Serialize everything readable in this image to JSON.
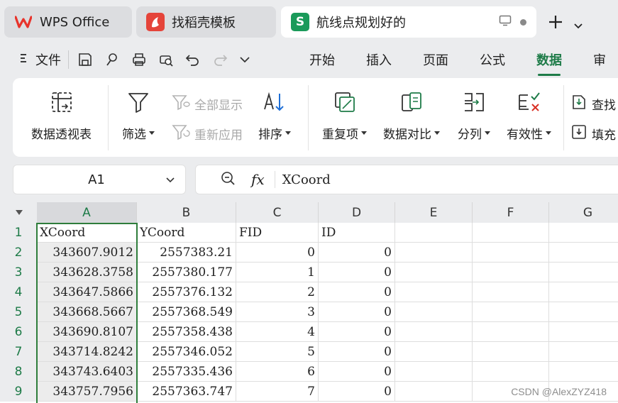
{
  "tabs": [
    {
      "label": "WPS Office",
      "icon": "wps-logo-icon"
    },
    {
      "label": "找稻壳模板",
      "icon": "docer-icon"
    },
    {
      "label": "航线点规划好的",
      "icon": "spreadsheet-icon",
      "icon_letter": "S"
    }
  ],
  "menu": {
    "file_label": "文件",
    "tabs": [
      "开始",
      "插入",
      "页面",
      "公式",
      "数据",
      "审"
    ],
    "active_tab": "数据"
  },
  "ribbon": {
    "pivot": "数据透视表",
    "filter": "筛选",
    "show_all": "全部显示",
    "reapply": "重新应用",
    "sort": "排序",
    "duplicates": "重复项",
    "compare": "数据对比",
    "split": "分列",
    "validity": "有效性",
    "find": "查找",
    "fill": "填充"
  },
  "formula_bar": {
    "name_box": "A1",
    "fx_label": "fx",
    "value": "XCoord"
  },
  "grid": {
    "columns": [
      "A",
      "B",
      "C",
      "D",
      "E",
      "F",
      "G"
    ],
    "rows": [
      "1",
      "2",
      "3",
      "4",
      "5",
      "6",
      "7",
      "8",
      "9"
    ],
    "cells": [
      [
        "XCoord",
        "YCoord",
        "FID",
        "ID"
      ],
      [
        "343607.9012",
        "2557383.21",
        "0",
        "0"
      ],
      [
        "343628.3758",
        "2557380.177",
        "1",
        "0"
      ],
      [
        "343647.5866",
        "2557376.132",
        "2",
        "0"
      ],
      [
        "343668.5667",
        "2557368.549",
        "3",
        "0"
      ],
      [
        "343690.8107",
        "2557358.438",
        "4",
        "0"
      ],
      [
        "343714.8242",
        "2557346.052",
        "5",
        "0"
      ],
      [
        "343743.6403",
        "2557335.436",
        "6",
        "0"
      ],
      [
        "343757.7956",
        "2557363.747",
        "7",
        "0"
      ]
    ],
    "selected_cell": "A1"
  },
  "watermark": "CSDN @AlexZYZ418",
  "colors": {
    "accent": "#1e7b48",
    "wps_red": "#e8332b",
    "docer_red": "#e5443a",
    "sheet_green": "#1a9a5a"
  }
}
